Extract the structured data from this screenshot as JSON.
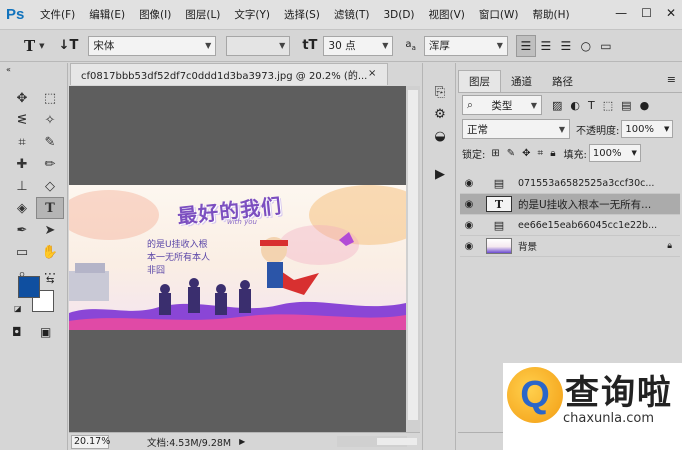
{
  "app": {
    "logo": "Ps"
  },
  "menu": [
    "文件(F)",
    "编辑(E)",
    "图像(I)",
    "图层(L)",
    "文字(Y)",
    "选择(S)",
    "滤镜(T)",
    "3D(D)",
    "视图(V)",
    "窗口(W)",
    "帮助(H)"
  ],
  "window_controls": {
    "minimize": "—",
    "maximize": "☐",
    "close": "✕"
  },
  "options": {
    "tool_icon": "T",
    "font_family": "宋体",
    "font_style": "",
    "font_size": "30 点",
    "aa_label": "a",
    "aa_value": "浑厚"
  },
  "document": {
    "tab_title": "cf0817bbb53df52df7c0ddd1d3ba3973.jpg @ 20.2% (的...",
    "close": "×"
  },
  "artwork": {
    "title": "最好的我们",
    "subtitle": "with you",
    "poem_lines": [
      "的是U挂收入根",
      "本一无所有本人",
      "非囧"
    ]
  },
  "status": {
    "zoom": "20.17%",
    "doc_size": "文档:4.53M/9.28M"
  },
  "layers_panel": {
    "tabs": [
      "图层",
      "通道",
      "路径"
    ],
    "filter_kind": "类型",
    "blend_mode": "正常",
    "opacity_label": "不透明度:",
    "opacity_value": "100%",
    "lock_label": "锁定:",
    "fill_label": "填充:",
    "fill_value": "100%",
    "layers": [
      {
        "name": "071553a6582525a3ccf30c...",
        "kind": "smart"
      },
      {
        "name": "的是U挂收入根本一无所有...",
        "kind": "text",
        "selected": true
      },
      {
        "name": "ee66e15eab66045cc1e22b...",
        "kind": "smart"
      },
      {
        "name": "背景",
        "kind": "image",
        "locked": true
      }
    ]
  },
  "watermark": {
    "logo_letter": "Q",
    "cn": "查询啦",
    "url": "chaxunla.com"
  },
  "colors": {
    "foreground": "#0f4fa0",
    "background": "#ffffff",
    "ps_blue": "#1173bd"
  }
}
